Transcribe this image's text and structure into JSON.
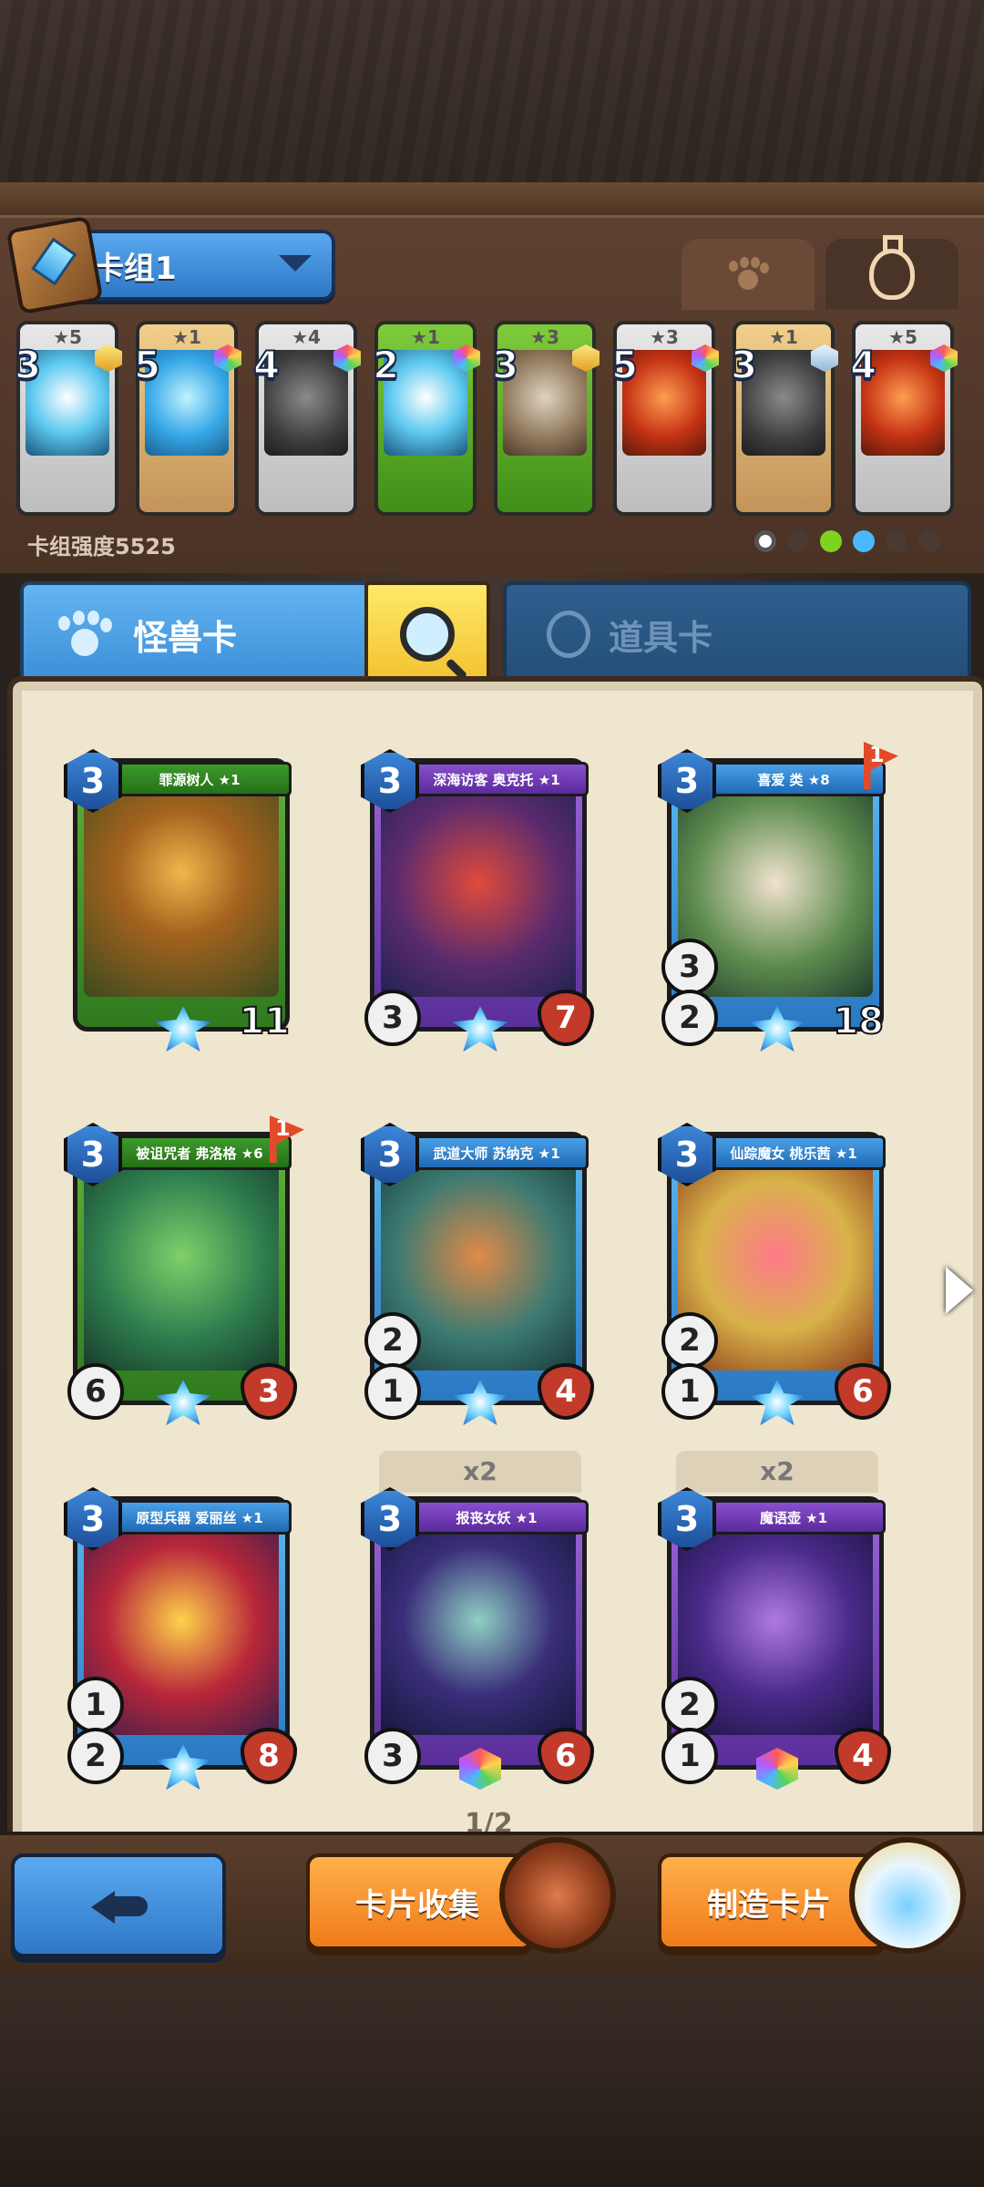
{
  "deck": {
    "name": "卡组1",
    "strength": "卡组强度5525",
    "cards": [
      {
        "cost": "3",
        "stars": "★5",
        "gem": "gold",
        "frame": "silver",
        "art": "teal"
      },
      {
        "cost": "5",
        "stars": "★1",
        "gem": "rainbow",
        "frame": "gold",
        "art": "blue"
      },
      {
        "cost": "4",
        "stars": "★4",
        "gem": "rainbow",
        "frame": "silver",
        "art": "dark"
      },
      {
        "cost": "2",
        "stars": "★1",
        "gem": "rainbow",
        "frame": "green",
        "art": "teal"
      },
      {
        "cost": "3",
        "stars": "★3",
        "gem": "gold",
        "frame": "green",
        "art": "steel"
      },
      {
        "cost": "5",
        "stars": "★3",
        "gem": "rainbow",
        "frame": "silver",
        "art": "red"
      },
      {
        "cost": "3",
        "stars": "★1",
        "gem": "silver",
        "frame": "gold",
        "art": "dark"
      },
      {
        "cost": "4",
        "stars": "★5",
        "gem": "rainbow",
        "frame": "silver",
        "art": "red"
      }
    ],
    "element_colors": [
      "#ffffff",
      "#4a3a32",
      "#7ed321",
      "#4ab8ff",
      "#4a3a32",
      "#4a3a32"
    ]
  },
  "tabs": {
    "monster": "怪兽卡",
    "item": "道具卡"
  },
  "cards": [
    {
      "name": "罪源树人 ★1",
      "cost": "3",
      "hp": "11",
      "atk": "",
      "atk2": "",
      "frame": "green",
      "art": "a1",
      "flag": "",
      "copies": "",
      "rainbow": false,
      "wide_hp": true
    },
    {
      "name": "深海访客 奥克托 ★1",
      "cost": "3",
      "hp": "7",
      "atk": "3",
      "atk2": "",
      "frame": "purple",
      "art": "a2",
      "flag": "",
      "copies": "",
      "rainbow": false,
      "wide_hp": false
    },
    {
      "name": "喜爱 类 ★8",
      "cost": "3",
      "hp": "18",
      "atk": "2",
      "atk2": "3",
      "frame": "blue",
      "art": "a3",
      "flag": "1",
      "copies": "",
      "rainbow": false,
      "wide_hp": true
    },
    {
      "name": "被诅咒者 弗洛格 ★6",
      "cost": "3",
      "hp": "3",
      "atk": "6",
      "atk2": "",
      "frame": "green",
      "art": "a4",
      "flag": "1",
      "copies": "",
      "rainbow": false,
      "wide_hp": false
    },
    {
      "name": "武道大师 苏纳克 ★1",
      "cost": "3",
      "hp": "4",
      "atk": "1",
      "atk2": "2",
      "frame": "blue",
      "art": "a5",
      "flag": "",
      "copies": "",
      "rainbow": false,
      "wide_hp": false
    },
    {
      "name": "仙踪魔女 桃乐茜 ★1",
      "cost": "3",
      "hp": "6",
      "atk": "1",
      "atk2": "2",
      "frame": "blue",
      "art": "a6",
      "flag": "",
      "copies": "",
      "rainbow": false,
      "wide_hp": false
    },
    {
      "name": "原型兵器 爱丽丝 ★1",
      "cost": "3",
      "hp": "8",
      "atk": "2",
      "atk2": "1",
      "frame": "blue",
      "art": "a7",
      "flag": "",
      "copies": "",
      "rainbow": false,
      "wide_hp": false
    },
    {
      "name": "报丧女妖 ★1",
      "cost": "3",
      "hp": "6",
      "atk": "3",
      "atk2": "",
      "frame": "purple",
      "art": "a8",
      "flag": "",
      "copies": "x2",
      "rainbow": true,
      "wide_hp": false
    },
    {
      "name": "魔语壶 ★1",
      "cost": "3",
      "hp": "4",
      "atk": "1",
      "atk2": "2",
      "frame": "purple",
      "art": "a9",
      "flag": "",
      "copies": "x2",
      "rainbow": true,
      "wide_hp": false
    }
  ],
  "page": "1/2",
  "buttons": {
    "collect": "卡片收集",
    "craft": "制造卡片"
  }
}
